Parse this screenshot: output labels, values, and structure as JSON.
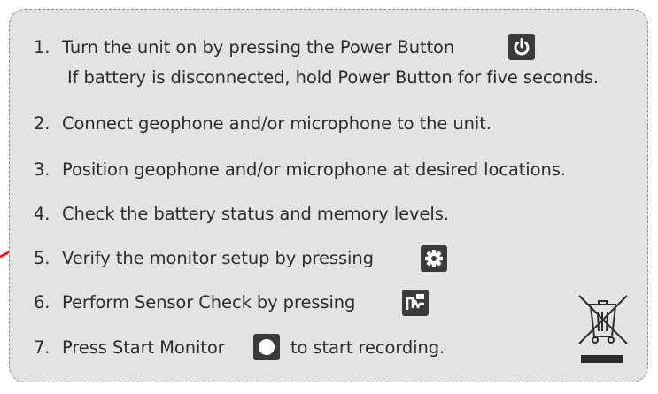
{
  "steps": [
    {
      "num": "1.",
      "text": "Turn the unit on by pressing the Power Button",
      "icon": "power-icon"
    },
    {
      "num": "",
      "text": "If battery is disconnected, hold Power Button for five seconds."
    },
    {
      "num": "2.",
      "text": "Connect geophone and/or microphone to the unit."
    },
    {
      "num": "3.",
      "text": "Position geophone and/or microphone at desired locations."
    },
    {
      "num": "4.",
      "text": "Check the battery status and memory levels."
    },
    {
      "num": "5.",
      "text": "Verify the monitor setup by pressing",
      "icon": "gear-icon"
    },
    {
      "num": "6.",
      "text": "Perform Sensor Check by pressing",
      "icon": "sensor-check-icon"
    },
    {
      "num": "7.",
      "text_before": "Press Start Monitor",
      "icon": "start-monitor-icon",
      "text_after": "to start recording."
    }
  ],
  "colors": {
    "card_background": "#e3e3e3",
    "text": "#2c2c2c",
    "icon_box": "#3a3a3a",
    "arrow": "#e8191a"
  },
  "annotations": {
    "arrow_target_step": "4."
  },
  "symbols": [
    "crossed-out-wheelie-bin-icon"
  ]
}
